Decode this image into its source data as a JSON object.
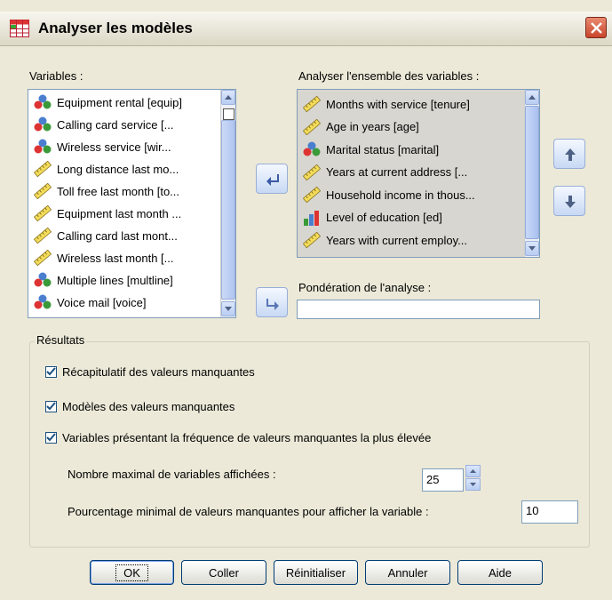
{
  "window": {
    "title": "Analyser les modèles"
  },
  "variables": {
    "label": "Variables :",
    "items": [
      {
        "label": "Equipment rental [equip]",
        "icon": "nominal-icon"
      },
      {
        "label": "Calling card service [...",
        "icon": "nominal-icon"
      },
      {
        "label": "Wireless service [wir...",
        "icon": "nominal-icon"
      },
      {
        "label": "Long distance last mo...",
        "icon": "scale-icon"
      },
      {
        "label": "Toll free last month [to...",
        "icon": "scale-icon"
      },
      {
        "label": "Equipment last month ...",
        "icon": "scale-icon"
      },
      {
        "label": "Calling card last mont...",
        "icon": "scale-icon"
      },
      {
        "label": "Wireless last month [...",
        "icon": "scale-icon"
      },
      {
        "label": "Multiple lines [multline]",
        "icon": "nominal-icon"
      },
      {
        "label": "Voice mail [voice]",
        "icon": "nominal-icon"
      }
    ]
  },
  "analyze": {
    "label": "Analyser l'ensemble des variables :",
    "items": [
      {
        "label": "Months with service [tenure]",
        "icon": "scale-icon"
      },
      {
        "label": "Age in years [age]",
        "icon": "scale-icon"
      },
      {
        "label": "Marital status [marital]",
        "icon": "nominal-icon"
      },
      {
        "label": "Years at current address [...",
        "icon": "scale-icon"
      },
      {
        "label": "Household income in thous...",
        "icon": "scale-icon"
      },
      {
        "label": "Level of education [ed]",
        "icon": "ordinal-icon"
      },
      {
        "label": "Years with current employ...",
        "icon": "scale-icon"
      }
    ]
  },
  "weight": {
    "label": "Pondération de l'analyse :",
    "value": ""
  },
  "results": {
    "group_label": "Résultats",
    "summary": {
      "label": "Récapitulatif des valeurs manquantes",
      "checked": true
    },
    "patterns": {
      "label": "Modèles des valeurs manquantes",
      "checked": true
    },
    "frequency": {
      "label": "Variables présentant la fréquence de valeurs manquantes la plus élevée",
      "checked": true
    },
    "max_vars_label": "Nombre maximal de variables affichées :",
    "max_vars_value": "25",
    "min_pct_label": "Pourcentage minimal de valeurs manquantes pour afficher la variable :",
    "min_pct_value": "10"
  },
  "buttons": {
    "ok": "OK",
    "paste": "Coller",
    "reset": "Réinitialiser",
    "cancel": "Annuler",
    "help": "Aide"
  },
  "colors": {
    "dialog_bg": "#ECE9D8",
    "list_border": "#7f9db9",
    "accent_blue": "#1c5180"
  }
}
